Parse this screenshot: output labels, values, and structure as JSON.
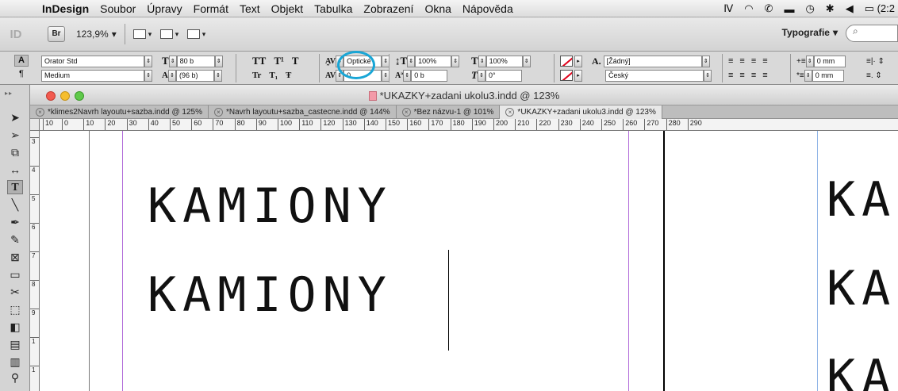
{
  "menubar": {
    "app": "InDesign",
    "items": [
      "Soubor",
      "Úpravy",
      "Formát",
      "Text",
      "Objekt",
      "Tabulka",
      "Zobrazení",
      "Okna",
      "Nápověda"
    ],
    "battery": "(2:2"
  },
  "appbar": {
    "logo": "ID",
    "bridge": "Br",
    "zoom": "123,9%",
    "workspace": "Typografie"
  },
  "control": {
    "font_family": "Orator Std",
    "font_style": "Medium",
    "font_size": "80 b",
    "leading": "(96 b)",
    "caps_all": "TT",
    "superscript": "T¹",
    "underline": "T",
    "small_caps": "Tr",
    "subscript": "T₁",
    "strike": "Ŧ",
    "kerning": "Optické",
    "tracking": "0",
    "v_scale": "100%",
    "h_scale": "100%",
    "baseline": "0 b",
    "skew": "0°",
    "char_style": "[Žádný]",
    "language": "Český",
    "indent_left": "0 mm",
    "indent_first": "0 mm"
  },
  "document": {
    "title": "*UKAZKY+zadani ukolu3.indd @ 123%",
    "tabs": [
      {
        "label": "*klimes2Navrh layoutu+sazba.indd @ 125%",
        "active": false
      },
      {
        "label": "*Navrh layoutu+sazba_castecne.indd @ 144%",
        "active": false
      },
      {
        "label": "*Bez názvu-1 @ 101%",
        "active": false
      },
      {
        "label": "*UKAZKY+zadani ukolu3.indd @ 123%",
        "active": true
      }
    ],
    "ruler_h": [
      "10",
      "0",
      "10",
      "20",
      "30",
      "40",
      "50",
      "60",
      "70",
      "80",
      "90",
      "100",
      "110",
      "120",
      "130",
      "140",
      "150",
      "160",
      "170",
      "180",
      "190",
      "200",
      "210",
      "220",
      "230",
      "240",
      "250",
      "260",
      "270",
      "280",
      "290"
    ],
    "ruler_v": [
      "3",
      "4",
      "5",
      "6",
      "7",
      "8",
      "9",
      "1",
      "1"
    ],
    "text_lines": [
      "KAMIONY",
      "KAMIONY"
    ],
    "right_page_lines": [
      "KA",
      "KA",
      "KA"
    ]
  },
  "colors": {
    "highlight": "#19a6d6",
    "margin_guide": "#b16bd9",
    "column_guide": "#8fb4e6"
  }
}
